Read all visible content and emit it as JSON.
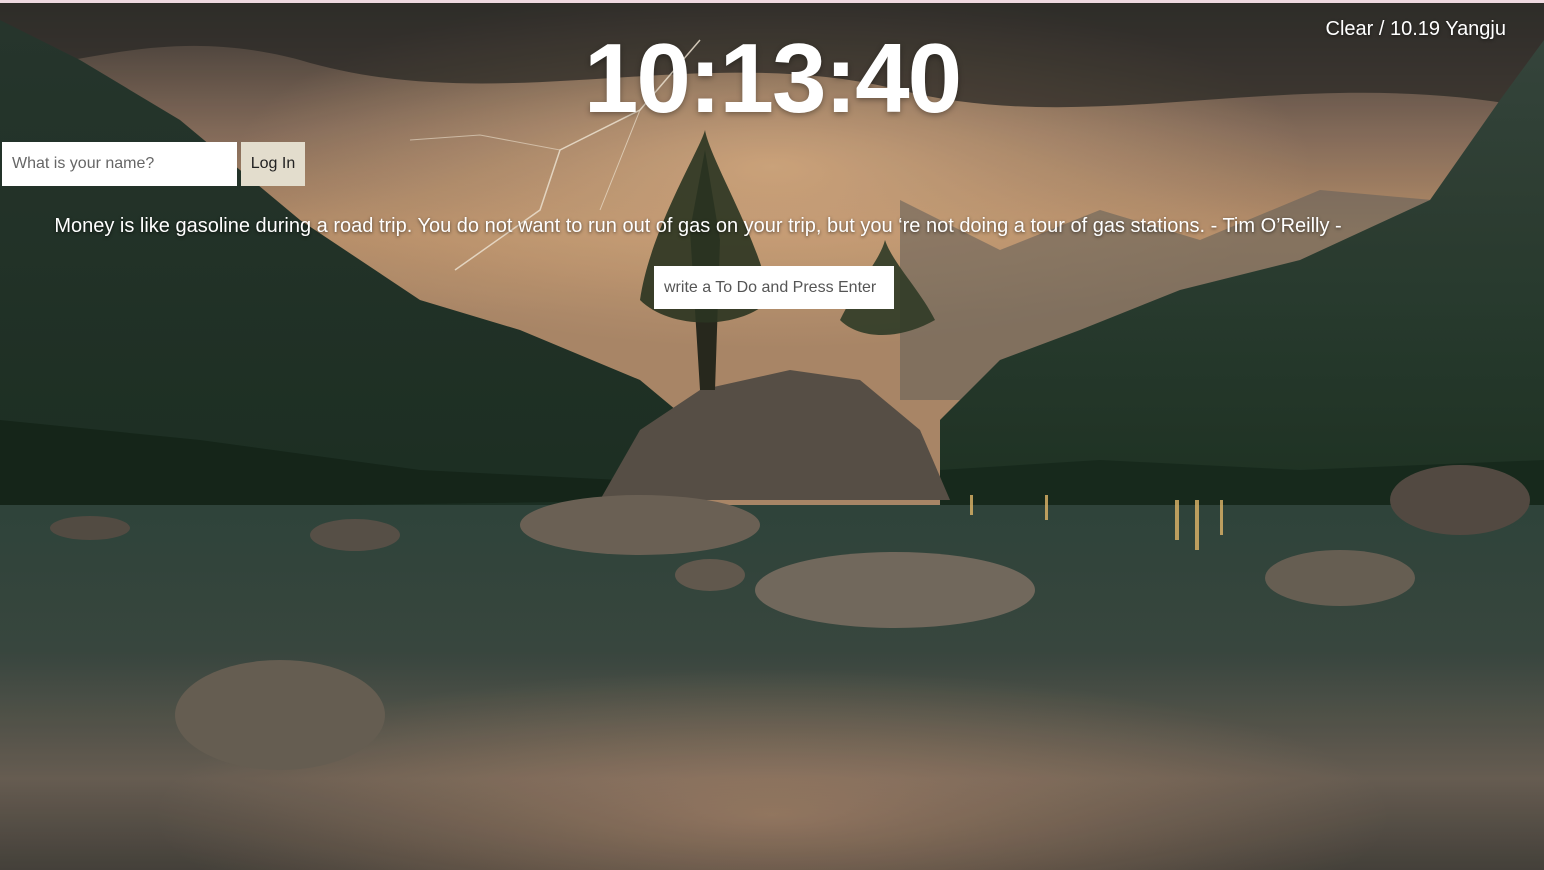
{
  "clock": {
    "time": "10:13:40"
  },
  "weather": {
    "text": "Clear / 10.19 Yangju"
  },
  "login": {
    "name_placeholder": "What is your name?",
    "button_label": "Log In"
  },
  "quote": {
    "text": "Money is like gasoline during a road trip. You do not want to run out of gas on your trip, but you ‘re not doing a tour of gas stations. - Tim O’Reilly -"
  },
  "todo": {
    "placeholder": "write a To Do and Press Enter"
  }
}
